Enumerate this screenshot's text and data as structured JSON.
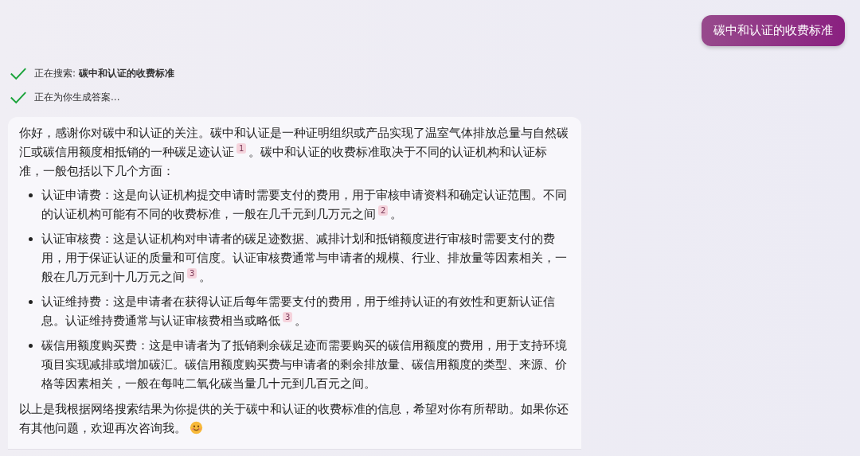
{
  "user_message": "碳中和认证的收费标准",
  "progress": [
    {
      "text": "正在搜索: **碳中和认证的收费标准**",
      "done": true
    },
    {
      "text": "正在为你生成答案...",
      "done": true
    }
  ],
  "answer": {
    "intro": [
      {
        "text": "你好，感谢你对碳中和认证的关注。碳中和认证是一种证明组织或产品实现了温室气体排放总量与自然碳汇或碳信用额度相抵销的一种碳足迹认证"
      },
      {
        "cite": "1"
      },
      {
        "text": "。碳中和认证的收费标准取决于不同的认证机构和认证标准，一般包括以下几个方面："
      }
    ],
    "items": [
      [
        {
          "text": "认证申请费：这是向认证机构提交申请时需要支付的费用，用于审核申请资料和确定认证范围。不同的认证机构可能有不同的收费标准，一般在几千元到几万元之间"
        },
        {
          "cite": "2"
        },
        {
          "text": "。"
        }
      ],
      [
        {
          "text": "认证审核费：这是认证机构对申请者的碳足迹数据、减排计划和抵销额度进行审核时需要支付的费用，用于保证认证的质量和可信度。认证审核费通常与申请者的规模、行业、排放量等因素相关，一般在几万元到十几万元之间"
        },
        {
          "cite": "3"
        },
        {
          "text": "。"
        }
      ],
      [
        {
          "text": "认证维持费：这是申请者在获得认证后每年需要支付的费用，用于维持认证的有效性和更新认证信息。认证维持费通常与认证审核费相当或略低"
        },
        {
          "cite": "3"
        },
        {
          "text": "。"
        }
      ],
      [
        {
          "text": "碳信用额度购买费：这是申请者为了抵销剩余碳足迹而需要购买的碳信用额度的费用，用于支持环境项目实现减排或增加碳汇。碳信用额度购买费与申请者的剩余排放量、碳信用额度的类型、来源、价格等因素相关，一般在每吨二氧化碳当量几十元到几百元之间。"
        }
      ]
    ],
    "closing": [
      {
        "text": "以上是我根据网络搜索结果为你提供的关于碳中和认证的收费标准的信息，希望对你有所帮助。如果你还有其他问题，欢迎再次咨询我。"
      }
    ]
  }
}
